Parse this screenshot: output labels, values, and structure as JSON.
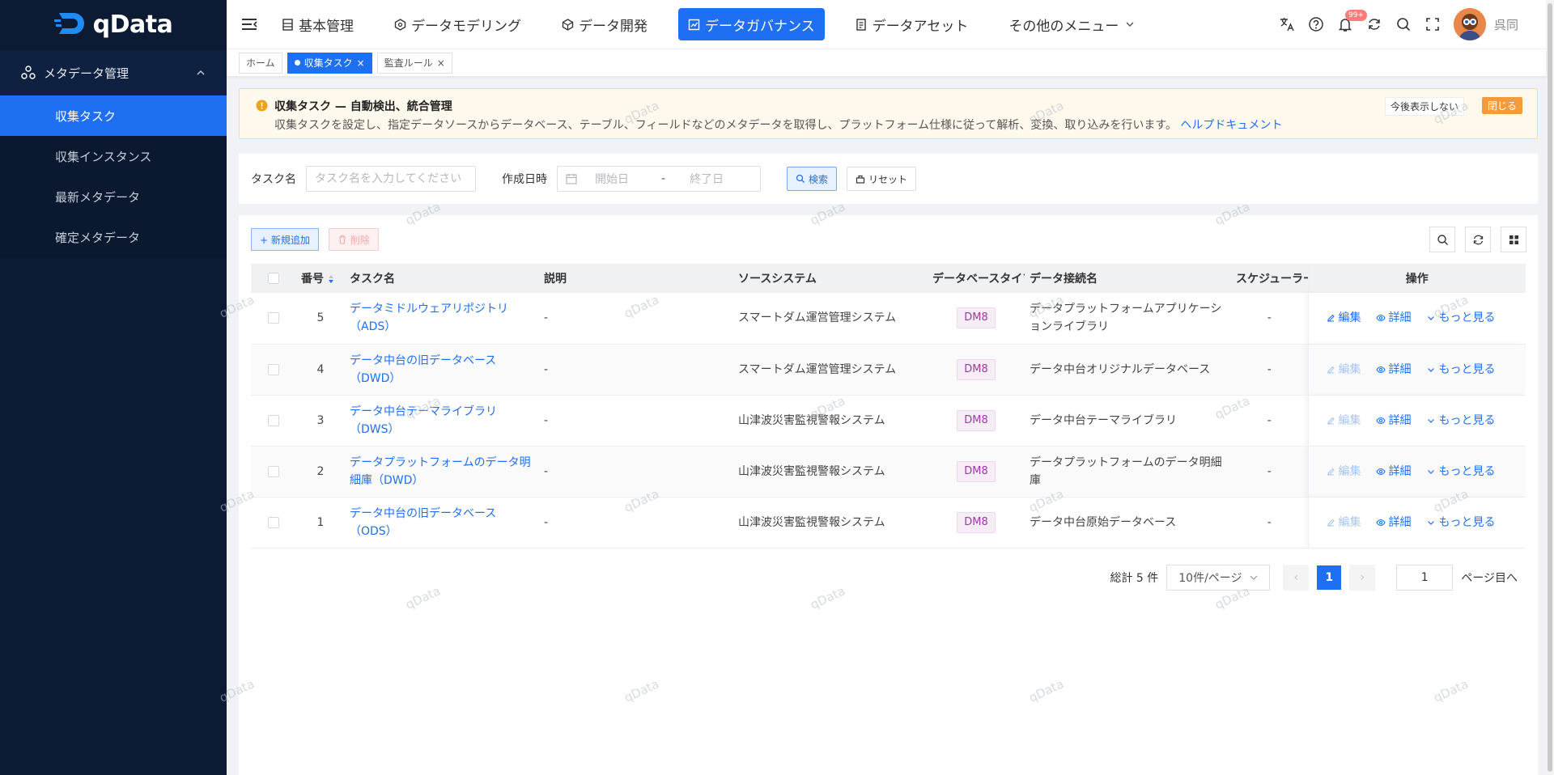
{
  "app": {
    "name": "qData",
    "username": "呉同",
    "notification_count": "99+",
    "accent": "#1f6ff2",
    "sidebar_bg": "#0c1a33"
  },
  "sidebar": {
    "group_label": "メタデータ管理",
    "items": [
      {
        "label": "収集タスク",
        "active": true
      },
      {
        "label": "収集インスタンス"
      },
      {
        "label": "最新メタデータ"
      },
      {
        "label": "確定メタデータ"
      }
    ]
  },
  "nav": {
    "items": [
      {
        "label": "基本管理",
        "icon": "grid-icon"
      },
      {
        "label": "データモデリング",
        "icon": "model-icon"
      },
      {
        "label": "データ開発",
        "icon": "cube-icon"
      },
      {
        "label": "データガバナンス",
        "icon": "governance-icon",
        "active": true
      },
      {
        "label": "データアセット",
        "icon": "asset-icon"
      }
    ],
    "more_label": "その他のメニュー"
  },
  "tabs": [
    {
      "label": "ホーム"
    },
    {
      "label": "収集タスク",
      "active": true
    },
    {
      "label": "監査ルール"
    }
  ],
  "notice": {
    "title": "収集タスク — 自動検出、統合管理",
    "desc": "収集タスクを設定し、指定データソースからデータベース、テーブル、フィールドなどのメタデータを取得し、プラットフォーム仕様に従って解析、変換、取り込みを行います。",
    "link": "ヘルプドキュメント",
    "hide_label": "今後表示しない",
    "close_label": "閉じる"
  },
  "search": {
    "task_label": "タスク名",
    "task_placeholder": "タスク名を入力してください",
    "date_label": "作成日時",
    "start_placeholder": "開始日",
    "end_placeholder": "終了日",
    "separator": "-",
    "search_btn": "検索",
    "reset_btn": "リセット"
  },
  "toolbar": {
    "add_label": "+ 新規追加",
    "delete_label": "削除"
  },
  "table": {
    "headers": {
      "no": "番号",
      "name": "タスク名",
      "desc": "説明",
      "source": "ソースシステム",
      "dbtype": "データベースタイプ",
      "conn": "データ接続名",
      "sched": "スケジューラー",
      "ops": "操作"
    },
    "op_labels": {
      "edit": "編集",
      "detail": "詳細",
      "more": "もっと見る"
    },
    "rows": [
      {
        "no": "5",
        "name": "データミドルウェアリポジトリ（ADS）",
        "desc": "-",
        "source": "スマートダム運営管理システム",
        "dbtype": "DM8",
        "conn": "データプラットフォームアプリケーションライブラリ",
        "sched": "-",
        "edit_enabled": true
      },
      {
        "no": "4",
        "name": "データ中台の旧データベース（DWD）",
        "desc": "-",
        "source": "スマートダム運営管理システム",
        "dbtype": "DM8",
        "conn": "データ中台オリジナルデータベース",
        "sched": "-",
        "edit_enabled": false
      },
      {
        "no": "3",
        "name": "データ中台テーマライブラリ（DWS）",
        "desc": "-",
        "source": "山津波災害監視警報システム",
        "dbtype": "DM8",
        "conn": "データ中台テーマライブラリ",
        "sched": "-",
        "edit_enabled": false
      },
      {
        "no": "2",
        "name": "データプラットフォームのデータ明細庫（DWD）",
        "desc": "-",
        "source": "山津波災害監視警報システム",
        "dbtype": "DM8",
        "conn": "データプラットフォームのデータ明細庫",
        "sched": "-",
        "edit_enabled": false
      },
      {
        "no": "1",
        "name": "データ中台の旧データベース（ODS）",
        "desc": "-",
        "source": "山津波災害監視警報システム",
        "dbtype": "DM8",
        "conn": "データ中台原始データベース",
        "sched": "-",
        "edit_enabled": false
      }
    ]
  },
  "pagination": {
    "total": "総計 5 件",
    "page_size": "10件/ページ",
    "current": "1",
    "jump_value": "1",
    "jump_suffix": "ページ目へ"
  },
  "watermark": "qData"
}
